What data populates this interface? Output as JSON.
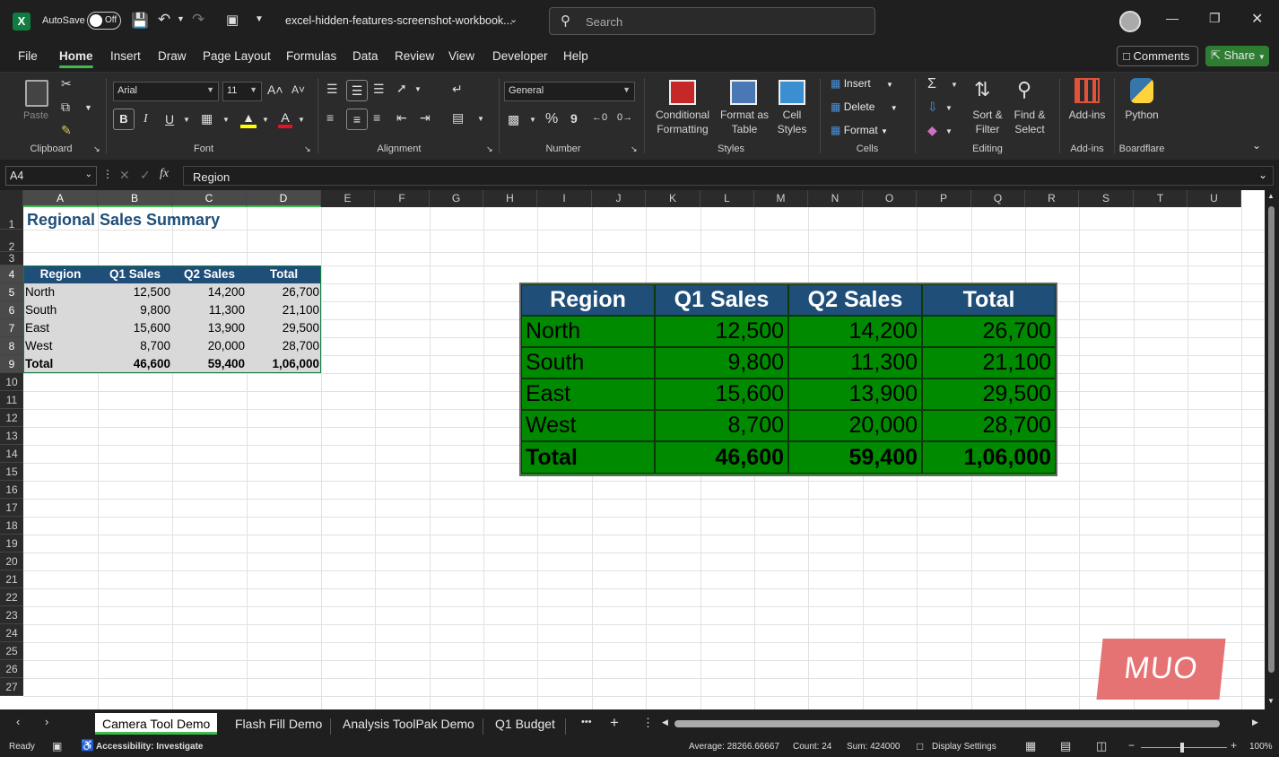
{
  "titlebar": {
    "autosave_label": "AutoSave",
    "autosave_state": "Off",
    "filename": "excel-hidden-features-screenshot-workbook...",
    "search_placeholder": "Search"
  },
  "menu": {
    "items": [
      "File",
      "Home",
      "Insert",
      "Draw",
      "Page Layout",
      "Formulas",
      "Data",
      "Review",
      "View",
      "Developer",
      "Help"
    ],
    "active": "Home",
    "comments_label": "Comments",
    "share_label": "Share"
  },
  "ribbon": {
    "clipboard": {
      "paste_label": "Paste",
      "group_label": "Clipboard"
    },
    "font": {
      "font_name": "Arial",
      "font_size": "11",
      "group_label": "Font",
      "bold": "B",
      "italic": "I",
      "underline": "U"
    },
    "alignment": {
      "group_label": "Alignment"
    },
    "number": {
      "format": "General",
      "group_label": "Number",
      "percent": "%",
      "comma": "9"
    },
    "styles": {
      "conditional": [
        "Conditional",
        "Formatting"
      ],
      "format_table": [
        "Format as",
        "Table"
      ],
      "cell_styles": [
        "Cell",
        "Styles"
      ],
      "group_label": "Styles"
    },
    "cells": {
      "insert": "Insert",
      "delete": "Delete",
      "format": "Format",
      "group_label": "Cells"
    },
    "editing": {
      "sort": [
        "Sort &",
        "Filter"
      ],
      "find": [
        "Find &",
        "Select"
      ],
      "group_label": "Editing"
    },
    "addins": {
      "label": "Add-ins",
      "group_label": "Add-ins"
    },
    "python": {
      "label": "Python",
      "group_label": "Boardflare"
    }
  },
  "formula_bar": {
    "name_box": "A4",
    "fx": "fx",
    "content": "Region"
  },
  "columns": [
    "A",
    "B",
    "C",
    "D",
    "E",
    "F",
    "G",
    "H",
    "I",
    "J",
    "K",
    "L",
    "M",
    "N",
    "O",
    "P",
    "Q",
    "R",
    "S",
    "T",
    "U"
  ],
  "rows": [
    "1",
    "2",
    "3",
    "4",
    "5",
    "6",
    "7",
    "8",
    "9",
    "10",
    "11",
    "12",
    "13",
    "14",
    "15",
    "16",
    "17",
    "18",
    "19",
    "20",
    "21",
    "22",
    "23",
    "24",
    "25",
    "26",
    "27"
  ],
  "sheet": {
    "title": "Regional Sales Summary",
    "headers": [
      "Region",
      "Q1 Sales",
      "Q2 Sales",
      "Total"
    ],
    "data": [
      [
        "North",
        "12,500",
        "14,200",
        "26,700"
      ],
      [
        "South",
        "9,800",
        "11,300",
        "21,100"
      ],
      [
        "East",
        "15,600",
        "13,900",
        "29,500"
      ],
      [
        "West",
        "8,700",
        "20,000",
        "28,700"
      ],
      [
        "Total",
        "46,600",
        "59,400",
        "1,06,000"
      ]
    ]
  },
  "picture": {
    "headers": [
      "Region",
      "Q1 Sales",
      "Q2 Sales",
      "Total"
    ],
    "data": [
      [
        "North",
        "12,500",
        "14,200",
        "26,700"
      ],
      [
        "South",
        "9,800",
        "11,300",
        "21,100"
      ],
      [
        "East",
        "15,600",
        "13,900",
        "29,500"
      ],
      [
        "West",
        "8,700",
        "20,000",
        "28,700"
      ],
      [
        "Total",
        "46,600",
        "59,400",
        "1,06,000"
      ]
    ],
    "header_color": "#1f4e79",
    "body_color": "#008a00"
  },
  "watermark": "MUO",
  "tabs": {
    "items": [
      "Camera Tool Demo",
      "Flash Fill Demo",
      "Analysis ToolPak Demo",
      "Q1 Budget"
    ],
    "active": "Camera Tool Demo",
    "more": "•••",
    "add": "+"
  },
  "status": {
    "ready": "Ready",
    "accessibility": "Accessibility: Investigate",
    "average": "Average: 28266.66667",
    "count": "Count: 24",
    "sum": "Sum: 424000",
    "display_settings": "Display Settings",
    "zoom": "100%"
  }
}
